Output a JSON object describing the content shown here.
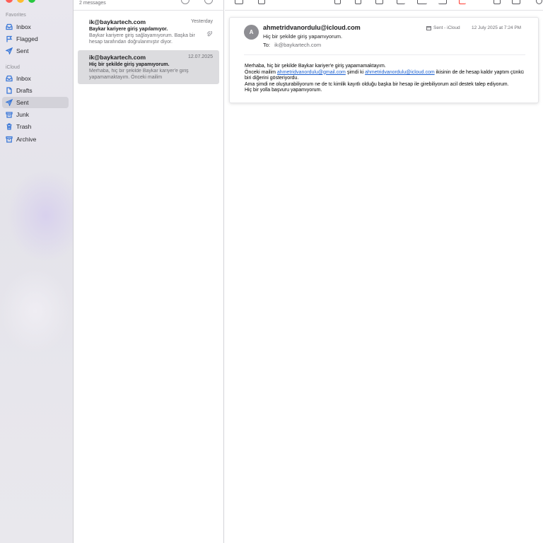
{
  "colors": {
    "accent": "#3b78d8",
    "traffic_red": "#fe5f57",
    "traffic_yellow": "#febc2e",
    "traffic_green": "#28c840",
    "flag_red": "#ff3b30",
    "link": "#1a5fd0"
  },
  "sidebar": {
    "favorites_label": "Favorites",
    "favorites": [
      {
        "label": "Inbox",
        "icon": "inbox-icon"
      },
      {
        "label": "Flagged",
        "icon": "flag-icon"
      },
      {
        "label": "Sent",
        "icon": "paperplane-icon"
      }
    ],
    "icloud_label": "iCloud",
    "icloud": [
      {
        "label": "Inbox",
        "icon": "inbox-icon"
      },
      {
        "label": "Drafts",
        "icon": "document-icon"
      },
      {
        "label": "Sent",
        "icon": "paperplane-icon",
        "selected": true
      },
      {
        "label": "Junk",
        "icon": "junk-icon"
      },
      {
        "label": "Trash",
        "icon": "trash-icon"
      },
      {
        "label": "Archive",
        "icon": "archive-icon"
      }
    ]
  },
  "message_list": {
    "count": "2 messages",
    "messages": [
      {
        "from": "ik@baykartech.com",
        "date": "Yesterday",
        "subject": "Baykar kariyere giriş yapılamıyor.",
        "preview": "Baykar kariyere giriş sağlayamıyorum. Başka bir hesap tarafından doğrulanmıştır diyor.",
        "has_attachment": true
      },
      {
        "from": "ik@baykartech.com",
        "date": "12.07.2025",
        "subject": "Hiç bir şekilde giriş yapamıyorum.",
        "preview": "Merhaba, hiç bir şekilde Baykar kariyer'e giriş yapamamaktayım. Önceki mailim ahmetridvanordulu@gmail.com",
        "selected": true
      }
    ]
  },
  "reading": {
    "avatar_initial": "A",
    "sender": "ahmetridvanordulu@icloud.com",
    "subject": "Hiç bir şekilde giriş yapamıyorum.",
    "to_label": "To:",
    "to_value": "ik@baykartech.com",
    "mailbox": "Sent - iCloud",
    "date": "12 July 2025 at 7:24 PM",
    "body": {
      "line1": "Merhaba, hiç bir şekilde Baykar kariyer'e giriş yapamamaktayım.",
      "line2_a": "Önceki mailim ",
      "link1": "ahmetridvanordulu@gmail.com",
      "line2_b": " şimdi ki ",
      "link2": "ahmetridvanordulu@icloud.com",
      "line2_c": " ikisinin de de hesap kaldır yaptım çünkü biri diğerini gösteriyordu.",
      "line3": "Ama şimdi ne oluşturabiliyorum ne de tc kimlik kayıtlı olduğu başka bir hesap ile girebiliyorum acil destek talep ediyorum.",
      "line4": "Hiç bir yolla başvuru yapamıyorum."
    }
  }
}
